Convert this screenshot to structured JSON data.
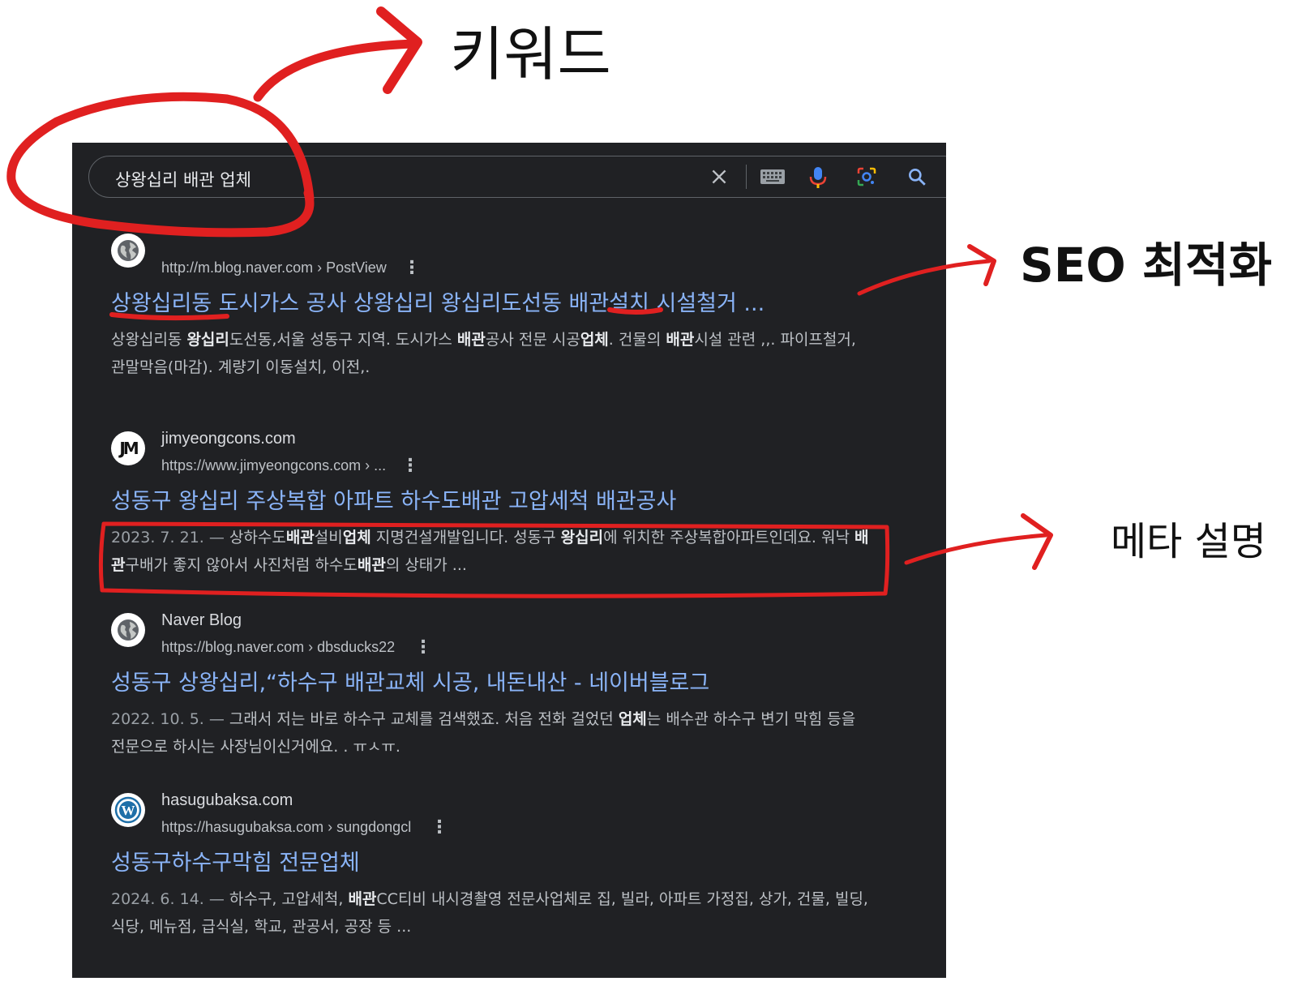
{
  "annotations": {
    "keyword": "키워드",
    "seo": "SEO 최적화",
    "meta": "메타 설명"
  },
  "search": {
    "query": "상왕십리 배관 업체"
  },
  "results": [
    {
      "site": "",
      "cite": "http://m.blog.naver.com › PostView",
      "title": "상왕십리동 도시가스 공사 상왕십리 왕십리도선동 배관설치 시설철거 ...",
      "snippet_parts": [
        {
          "t": "상왕십리동 ",
          "b": false
        },
        {
          "t": "왕십리",
          "b": true
        },
        {
          "t": "도선동,서울 성동구 지역. 도시가스 ",
          "b": false
        },
        {
          "t": "배관",
          "b": true
        },
        {
          "t": "공사 전문 시공",
          "b": false
        },
        {
          "t": "업체",
          "b": true
        },
        {
          "t": ". 건물의 ",
          "b": false
        },
        {
          "t": "배관",
          "b": true
        },
        {
          "t": "시설 관련 ,,. 파이프철거, 관말막음(마감). 계량기 이동설치, 이전,.",
          "b": false
        }
      ]
    },
    {
      "site": "jimyeongcons.com",
      "cite": "https://www.jimyeongcons.com › ...",
      "title": "성동구 왕십리 주상복합 아파트 하수도배관 고압세척 배관공사",
      "snippet_parts": [
        {
          "t": "2023. 7. 21. — ",
          "d": true
        },
        {
          "t": "상하수도",
          "b": false
        },
        {
          "t": "배관",
          "b": true
        },
        {
          "t": "설비",
          "b": false
        },
        {
          "t": "업체",
          "b": true
        },
        {
          "t": " 지명건설개발입니다. 성동구 ",
          "b": false
        },
        {
          "t": "왕십리",
          "b": true
        },
        {
          "t": "에 위치한 주상복합아파트인데요. 워낙 ",
          "b": false
        },
        {
          "t": "배관",
          "b": true
        },
        {
          "t": "구배가 좋지 않아서 사진처럼 하수도",
          "b": false
        },
        {
          "t": "배관",
          "b": true
        },
        {
          "t": "의 상태가 ...",
          "b": false
        }
      ]
    },
    {
      "site": "Naver Blog",
      "cite": "https://blog.naver.com › dbsducks22",
      "title": "성동구 상왕십리,“하수구 배관교체 시공, 내돈내산 - 네이버블로그",
      "snippet_parts": [
        {
          "t": "2022. 10. 5. — ",
          "d": true
        },
        {
          "t": "그래서 저는 바로 하수구 교체를 검색했죠. 처음 전화 걸었던 ",
          "b": false
        },
        {
          "t": "업체",
          "b": true
        },
        {
          "t": "는 배수관 하수구 변기 막힘 등을 전문으로 하시는 사장님이신거에요. . ㅠㅅㅠ.",
          "b": false
        }
      ]
    },
    {
      "site": "hasugubaksa.com",
      "cite": "https://hasugubaksa.com › sungdongcl",
      "title": "성동구하수구막힘 전문업체",
      "snippet_parts": [
        {
          "t": "2024. 6. 14. — ",
          "d": true
        },
        {
          "t": "하수구, 고압세척, ",
          "b": false
        },
        {
          "t": "배관",
          "b": true
        },
        {
          "t": "CC티비 내시경촬영 전문사업체로 집, 빌라, 아파트 가정집, 상가, 건물, 빌딩, 식당, 메뉴점, 급식실, 학교, 관공서, 공장 등 ...",
          "b": false
        }
      ]
    }
  ],
  "icons": {
    "result_0": "globe-icon",
    "result_1": "jm-logo-icon",
    "result_2": "globe-icon",
    "result_3": "wordpress-icon"
  },
  "colors": {
    "panel_bg": "#202124",
    "link": "#8ab4f8",
    "annotation_red": "#e02020"
  }
}
